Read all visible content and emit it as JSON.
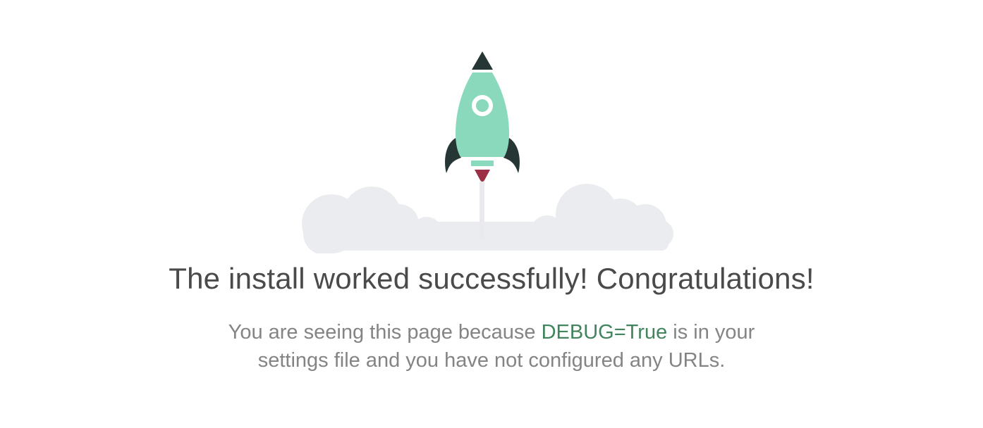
{
  "illustration": {
    "icon": "rocket-icon",
    "clouds_icon": "clouds-icon"
  },
  "headline": "The install worked successfully! Congratulations!",
  "message": {
    "before": "You are seeing this page because ",
    "code": "DEBUG=True",
    "after": " is in your settings file and you have not configured any URLs."
  },
  "colors": {
    "background": "#ffffff",
    "headline_text": "#4a4a4a",
    "body_text": "#848484",
    "accent_green": "#41845e",
    "rocket_body": "#8ad9bd",
    "rocket_dark": "#263634",
    "rocket_flame": "#9b2f45",
    "clouds": "#ebecef",
    "exhaust_trail": "#e9e9ee"
  }
}
